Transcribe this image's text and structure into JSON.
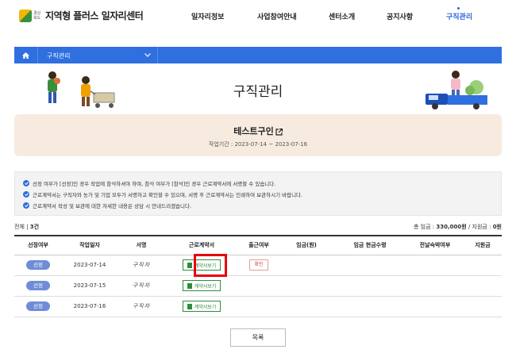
{
  "header": {
    "logo_sub": "경상북도",
    "logo_text": "지역형 플러스 일자리센터",
    "nav": [
      "일자리정보",
      "사업참여안내",
      "센터소개",
      "공지사항",
      "구직관리"
    ]
  },
  "location": {
    "label": "구직관리"
  },
  "page": {
    "title": "구직관리"
  },
  "job": {
    "title": "테스트구인",
    "period": "작업기간 : 2023-07-14 ~ 2023-07-16"
  },
  "notices": [
    "선정 여부가 [선정]인 경우 작업에 참석하셔야 하며, 참석 여부가 [참석]인 경우 근로계약서에 서명할 수 있습니다.",
    "근로계약서는 구직자와 농가 및 기업 모두가 서명하고 확인할 수 있으며, 서명 후 근로계약서는 인쇄하여 보관하시기 바랍니다.",
    "근로계약서 작성 및 보관에 대한 자세한 내용은 상담 시 안내드리겠습니다."
  ],
  "summary": {
    "total_label": "전체",
    "total_count": "3건",
    "wage_label": "총 임금 :",
    "wage_value": "330,000원",
    "support_label": "/ 지원금 :",
    "support_value": "0원"
  },
  "table": {
    "headers": [
      "선정여부",
      "작업일자",
      "서명",
      "근로계약서",
      "출근여부",
      "임금(원)",
      "임금 현금수령",
      "전날숙박여부",
      "지원금"
    ],
    "rows": [
      {
        "status": "선정",
        "date": "2023-07-14",
        "signature": "구직자",
        "contract": "계약서보기",
        "attendance": "확인"
      },
      {
        "status": "선정",
        "date": "2023-07-15",
        "signature": "구직자",
        "contract": "계약서보기",
        "attendance": ""
      },
      {
        "status": "선정",
        "date": "2023-07-16",
        "signature": "구직자",
        "contract": "계약서보기",
        "attendance": ""
      }
    ]
  },
  "buttons": {
    "list": "목록"
  },
  "colors": {
    "primary": "#2f6fe0",
    "highlight": "#e8000b",
    "contract": "#2e8b3e",
    "infobox": "#f7ebe0"
  },
  "icons": [
    "home-icon",
    "chevron-down-icon",
    "external-link-icon",
    "check-circle-icon",
    "document-icon"
  ]
}
